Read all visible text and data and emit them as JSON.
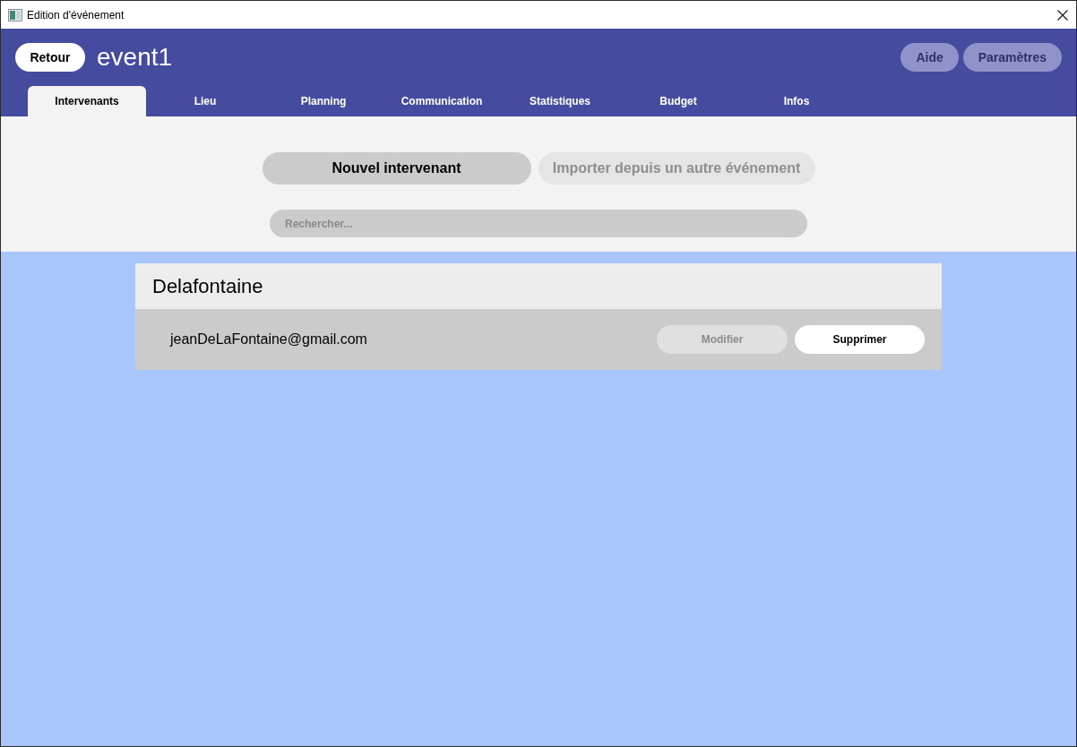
{
  "window": {
    "title": "Edition d'événement"
  },
  "header": {
    "back_button": "Retour",
    "event_name": "event1",
    "buttons": [
      "Aide",
      "Paramètres"
    ]
  },
  "tabs": [
    {
      "label": "Intervenants",
      "selected": true
    },
    {
      "label": "Lieu",
      "selected": false
    },
    {
      "label": "Planning",
      "selected": false
    },
    {
      "label": "Communication",
      "selected": false
    },
    {
      "label": "Statistiques",
      "selected": false
    },
    {
      "label": "Budget",
      "selected": false
    },
    {
      "label": "Infos",
      "selected": false
    }
  ],
  "actions": [
    {
      "label": "Nouvel intervenant",
      "disabled": false
    },
    {
      "label": "Importer depuis un autre événement",
      "disabled": true
    }
  ],
  "search": {
    "placeholder": "Rechercher..."
  },
  "speakers": [
    {
      "name": "Delafontaine",
      "email": "jeanDeLaFontaine@gmail.com",
      "buttons": [
        {
          "label": "Modifier",
          "disabled": true
        },
        {
          "label": "Supprimer",
          "disabled": false
        }
      ]
    }
  ]
}
